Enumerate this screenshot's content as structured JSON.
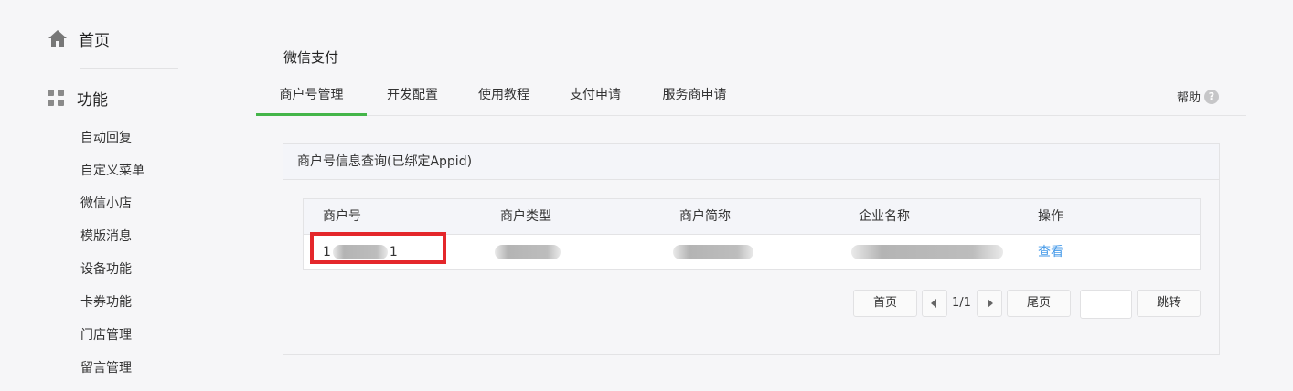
{
  "sidebar": {
    "home_label": "首页",
    "home_icon": "home-icon",
    "func_label": "功能",
    "func_icon": "grid-icon",
    "items": [
      "自动回复",
      "自定义菜单",
      "微信小店",
      "模版消息",
      "设备功能",
      "卡券功能",
      "门店管理",
      "留言管理"
    ]
  },
  "page_title": "微信支付",
  "tabs": [
    "商户号管理",
    "开发配置",
    "使用教程",
    "支付申请",
    "服务商申请"
  ],
  "active_tab": "商户号管理",
  "help": {
    "label": "帮助",
    "icon": "help-icon"
  },
  "panel": {
    "title": "商户号信息查询(已绑定Appid)",
    "columns": [
      "商户号",
      "商户类型",
      "商户简称",
      "企业名称",
      "操作"
    ],
    "row": {
      "merchant_id_start": "1",
      "merchant_id_end": "1",
      "action": "查看"
    }
  },
  "pagination": {
    "first": "首页",
    "page_info": "1/1",
    "last": "尾页",
    "jump": "跳转",
    "jump_input": ""
  },
  "colors": {
    "accent_green": "#44b549",
    "link_blue": "#459ae9",
    "highlight_red": "#e4272b"
  }
}
